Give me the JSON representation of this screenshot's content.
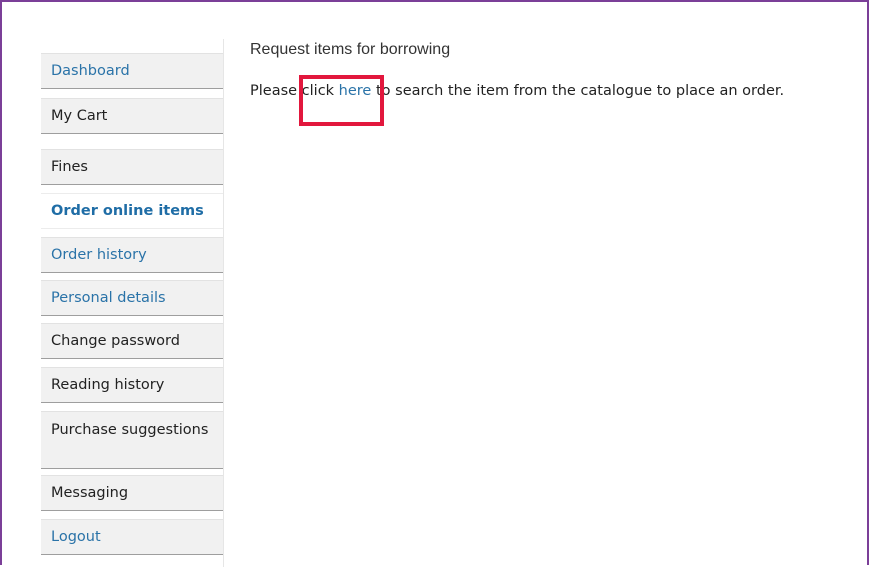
{
  "sidebar": {
    "items": [
      {
        "label": "Dashboard"
      },
      {
        "label": "My Cart"
      },
      {
        "label": "Fines"
      },
      {
        "label": "Order online items"
      },
      {
        "label": "Order history"
      },
      {
        "label": "Personal details"
      },
      {
        "label": "Change password"
      },
      {
        "label": "Reading history"
      },
      {
        "label": "Purchase suggestions"
      },
      {
        "label": "Messaging"
      },
      {
        "label": "Logout"
      }
    ]
  },
  "main": {
    "title": "Request items for borrowing",
    "instruction_before": "Please click ",
    "instruction_link": "here",
    "instruction_after": " to search the item from the catalogue to place an order."
  },
  "colors": {
    "frame_border": "#7b3f98",
    "link": "#2a73a8",
    "active": "#1f6da6",
    "highlight": "#e2173d"
  }
}
